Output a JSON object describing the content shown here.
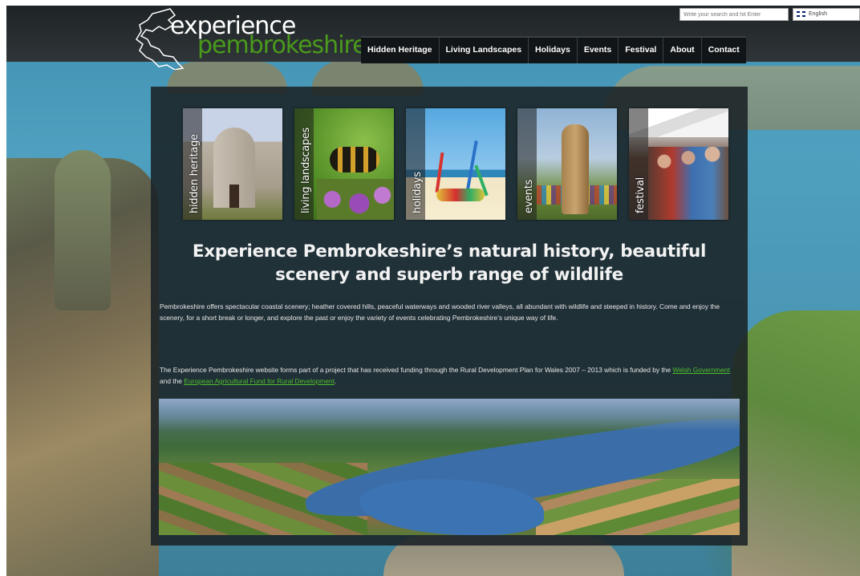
{
  "site": {
    "logo_line1": "experience",
    "logo_line2": "pembrokeshire"
  },
  "search": {
    "placeholder": "Write your search and hit Enter"
  },
  "language": {
    "selected": "English"
  },
  "nav": {
    "items": [
      {
        "label": "Hidden Heritage"
      },
      {
        "label": "Living Landscapes"
      },
      {
        "label": "Holidays"
      },
      {
        "label": "Events"
      },
      {
        "label": "Festival"
      },
      {
        "label": "About"
      },
      {
        "label": "Contact"
      }
    ]
  },
  "tiles": [
    {
      "label": "hidden heritage"
    },
    {
      "label": "living landscapes"
    },
    {
      "label": "holidays"
    },
    {
      "label": "events"
    },
    {
      "label": "festival"
    }
  ],
  "main": {
    "headline": "Experience Pembrokeshire’s natural history, beautiful scenery and superb range of wildlife",
    "intro": "Pembrokeshire offers spectacular coastal scenery; heather covered hills, peaceful waterways and wooded river valleys, all abundant with wildlife and steeped in history.  Come and enjoy the scenery, for a short break or longer, and explore the past or enjoy the variety of events celebrating Pembrokeshire’s unique way of life.",
    "funding_prefix": "The Experience Pembrokeshire website forms part of a project that has received funding through the Rural Development Plan for Wales 2007 – 2013 which is funded by the ",
    "funding_link1": "Welsh Government",
    "funding_mid": " and the ",
    "funding_link2": "European Agricultural Fund for Rural Development",
    "funding_suffix": "."
  },
  "colors": {
    "accent_green": "#4fbf2c",
    "header_bg": "#1e2326",
    "panel_bg": "#1a2226"
  }
}
